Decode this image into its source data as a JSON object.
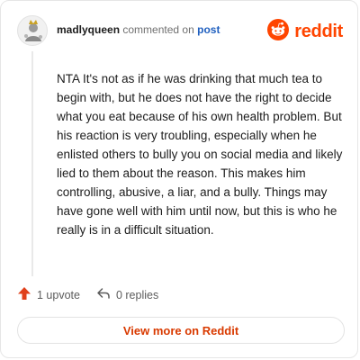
{
  "comment": {
    "username": "madlyqueen",
    "action_text": "commented on",
    "post_link": "post",
    "body": "NTA It's not as if he was drinking that much tea to begin with, but he does not have the right to decide what you eat because of his own health problem. But his reaction is very troubling, especially when he enlisted others to bully you on social media and likely lied to them about the reason. This makes him controlling, abusive, a liar, and a bully. Things may have gone well with him until now, but this is who he really is in a difficult situation."
  },
  "brand": {
    "name": "reddit",
    "color": "#ff4500",
    "icon": "reddit-logo-icon"
  },
  "actions": {
    "upvotes": "1 upvote",
    "upvote_icon": "upvote-arrow-icon",
    "upvote_color": "#e0401b",
    "replies": "0 replies",
    "reply_icon": "reply-arrow-icon"
  },
  "footer": {
    "view_more": "View more on Reddit",
    "view_more_color": "#d93a00"
  }
}
